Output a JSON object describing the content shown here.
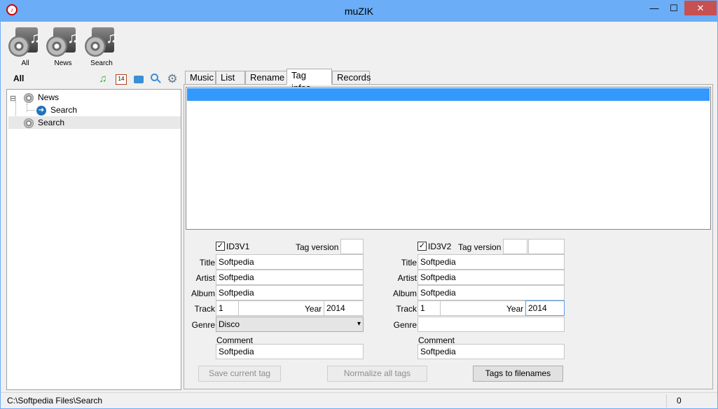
{
  "window": {
    "title": "muZIK",
    "app_icon": "muzik-logo-icon",
    "minimize": "—",
    "maximize": "☐",
    "close": "✕"
  },
  "toolbar": {
    "items": [
      {
        "label": "All"
      },
      {
        "label": "News"
      },
      {
        "label": "Search"
      }
    ]
  },
  "left": {
    "filter_label": "All",
    "icons": [
      "music-note-icon",
      "calendar-icon",
      "folder-icon",
      "search-icon",
      "gear-icon"
    ],
    "calendar_day": "14",
    "tree": [
      {
        "label": "News",
        "expander": "⊟"
      },
      {
        "label": "Search"
      },
      {
        "label": "Search"
      }
    ]
  },
  "tabs": [
    "Music",
    "List",
    "Rename",
    "Tag infos",
    "Records"
  ],
  "active_tab": "Tag infos",
  "id3v1": {
    "checkbox_label": "ID3V1",
    "checked": true,
    "tag_version_label": "Tag version",
    "tag_version": "",
    "title_label": "Title",
    "title": "Softpedia",
    "artist_label": "Artist",
    "artist": "Softpedia",
    "album_label": "Album",
    "album": "Softpedia",
    "track_label": "Track",
    "track": "1",
    "year_label": "Year",
    "year": "2014",
    "genre_label": "Genre",
    "genre": "Disco",
    "comment_label": "Comment",
    "comment": "Softpedia"
  },
  "id3v2": {
    "checkbox_label": "ID3V2",
    "checked": true,
    "tag_version_label": "Tag version",
    "tag_version": "",
    "title_label": "Title",
    "title": "Softpedia",
    "artist_label": "Artist",
    "artist": "Softpedia",
    "album_label": "Album",
    "album": "Softpedia",
    "track_label": "Track",
    "track": "1",
    "year_label": "Year",
    "year": "2014",
    "genre_label": "Genre",
    "genre": "",
    "comment_label": "Comment",
    "comment": "Softpedia"
  },
  "buttons": {
    "save": "Save current tag",
    "normalize": "Normalize all tags",
    "tags_to_filenames": "Tags to filenames"
  },
  "status": {
    "path": "C:\\Softpedia Files\\Search",
    "count": "0"
  },
  "colors": {
    "titlebar": "#6badf6",
    "selection": "#3399ff",
    "close": "#c75050"
  }
}
